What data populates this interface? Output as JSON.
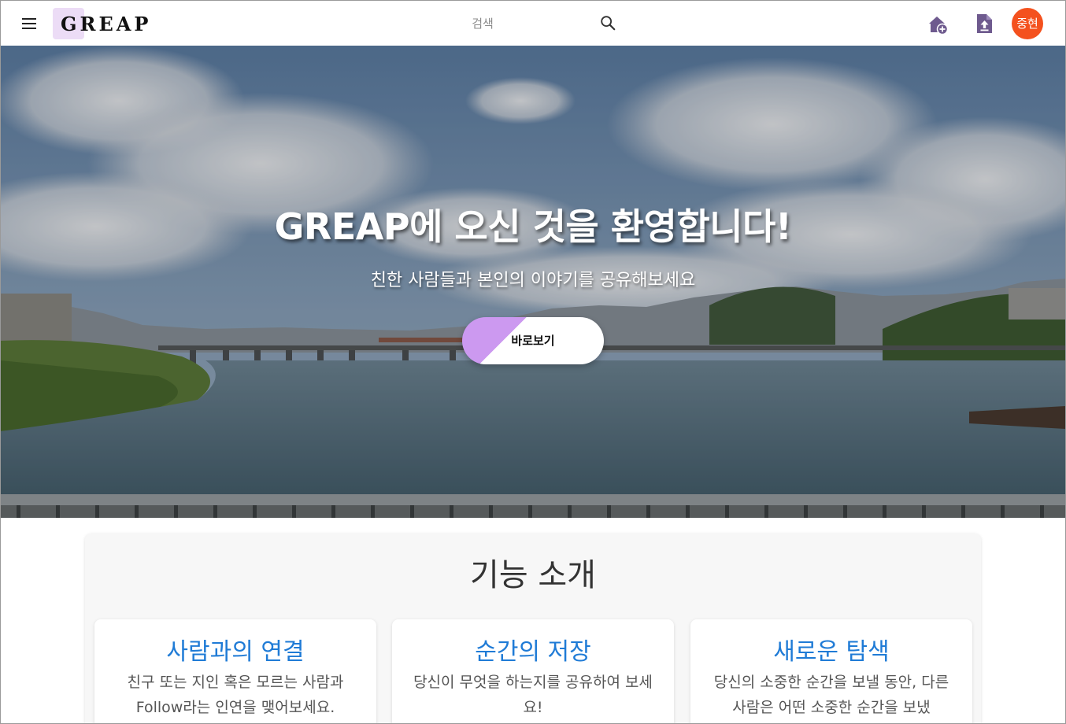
{
  "header": {
    "logo": "GREAP",
    "search_placeholder": "검색",
    "avatar_text": "중현"
  },
  "hero": {
    "title": "GREAP에 오신 것을 환영합니다!",
    "subtitle": "친한 사람들과 본인의 이야기를 공유해보세요",
    "cta_label": "바로보기"
  },
  "features": {
    "title": "기능 소개",
    "cards": [
      {
        "title": "사람과의 연결",
        "description": "친구 또는 지인 혹은 모르는 사람과 Follow라는 인연을 맺어보세요."
      },
      {
        "title": "순간의 저장",
        "description": "당신이 무엇을 하는지를 공유하여 보세요!"
      },
      {
        "title": "새로운 탐색",
        "description": "당신의 소중한 순간을 보낼 동안, 다른 사람은 어떤 소중한 순간을 보냈"
      }
    ]
  },
  "colors": {
    "accent_blue": "#1f7bd6",
    "avatar_orange": "#f4511e",
    "cta_purple": "#cc99f0",
    "logo_bg": "#ecdcf6",
    "icon_purple": "#6e5a8e"
  },
  "icons": [
    "menu-icon",
    "search-icon",
    "home-add-icon",
    "upload-icon"
  ]
}
